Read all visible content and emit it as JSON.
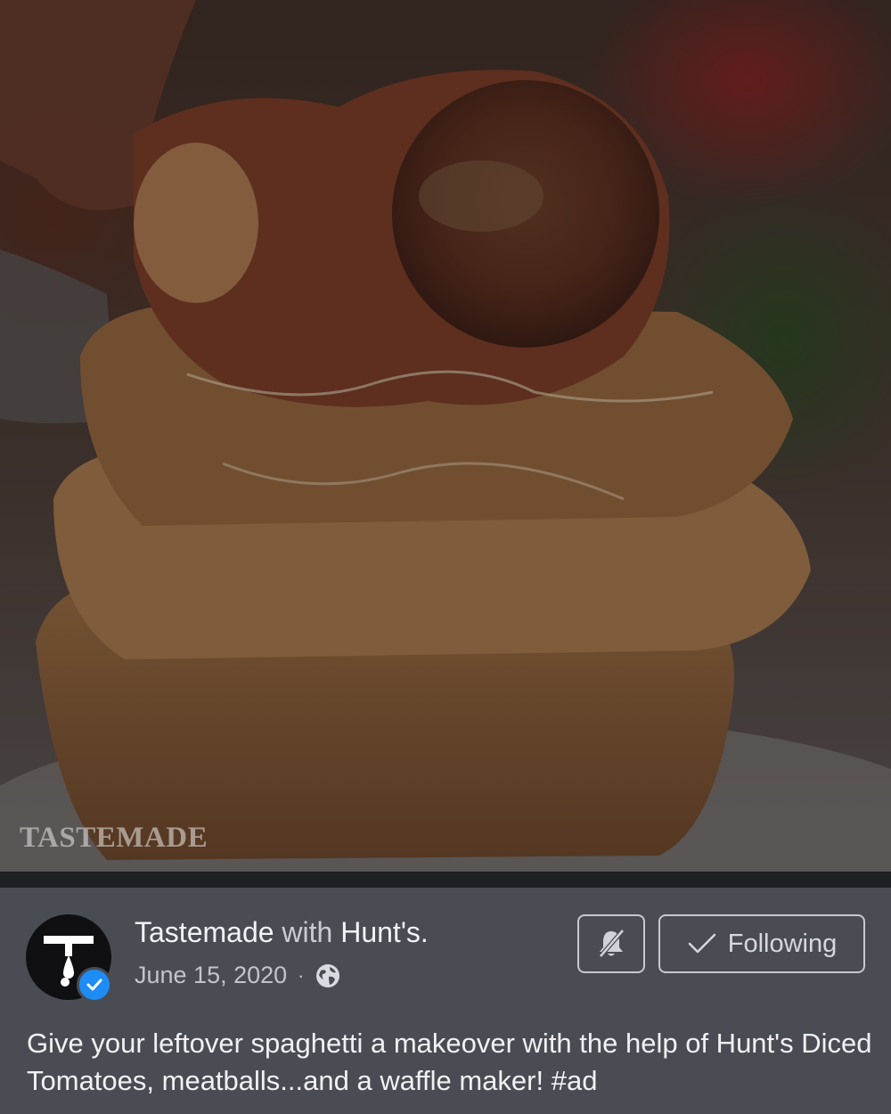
{
  "video": {
    "watermark": "TASTEMADE"
  },
  "post": {
    "author": "Tastemade",
    "with_text": "with",
    "partner": "Hunt's.",
    "date": "June 15, 2020",
    "separator": "·",
    "privacy_icon": "globe-icon",
    "caption": "Give your leftover spaghetti a makeover with the help of Hunt's Diced Tomatoes, meatballs...and a waffle maker! #ad"
  },
  "buttons": {
    "mute_icon": "bell-slash-icon",
    "follow_label": "Following",
    "follow_icon": "checkmark-icon"
  },
  "colors": {
    "panel_bg": "#494c53",
    "verified_badge": "#1d8df5",
    "button_border": "#c6c9cf"
  }
}
